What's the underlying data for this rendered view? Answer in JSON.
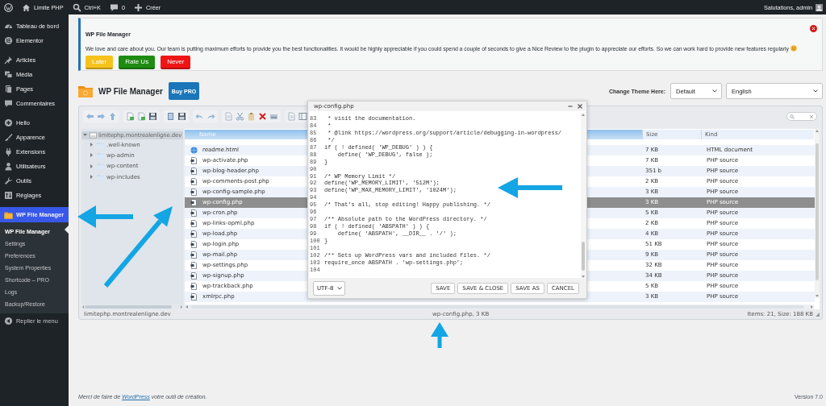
{
  "admin_bar": {
    "items": [
      {
        "kind": "logo"
      },
      {
        "kind": "home",
        "label": "Limite PHP"
      },
      {
        "kind": "search",
        "label": "Ctrl+K"
      },
      {
        "kind": "comments",
        "label": "0"
      },
      {
        "kind": "new",
        "label": "Créer"
      }
    ],
    "greeting": "Salutations, admin"
  },
  "sidebar": {
    "groups": [
      {
        "items": [
          {
            "label": "Tableau de bord",
            "kind": "gauge",
            "selected": false
          },
          {
            "label": "Elementor",
            "kind": "elementor",
            "selected": false
          }
        ]
      },
      {
        "items": [
          {
            "label": "Articles",
            "kind": "pin",
            "selected": false
          },
          {
            "label": "Média",
            "kind": "media",
            "selected": false
          },
          {
            "label": "Pages",
            "kind": "pages",
            "selected": false
          },
          {
            "label": "Commentaires",
            "kind": "comment",
            "selected": false
          }
        ]
      },
      {
        "items": [
          {
            "label": "Hello",
            "kind": "hello",
            "selected": false
          },
          {
            "label": "Apparence",
            "kind": "brush",
            "selected": false
          },
          {
            "label": "Extensions",
            "kind": "plug",
            "selected": false
          },
          {
            "label": "Utilisateurs",
            "kind": "user",
            "selected": false
          },
          {
            "label": "Outils",
            "kind": "wrench",
            "selected": false
          },
          {
            "label": "Réglages",
            "kind": "sliders",
            "selected": false
          }
        ]
      },
      {
        "items": [
          {
            "label": "WP File Manager",
            "kind": "folder",
            "selected": true,
            "submenu": [
              {
                "label": "WP File Manager",
                "selected": true
              },
              {
                "label": "Settings",
                "selected": false
              },
              {
                "label": "Preferences",
                "selected": false
              },
              {
                "label": "System Properties",
                "selected": false
              },
              {
                "label": "Shortcode – PRO",
                "selected": false
              },
              {
                "label": "Logs",
                "selected": false
              },
              {
                "label": "Backup/Restore",
                "selected": false
              }
            ]
          }
        ]
      }
    ],
    "collapse": "Replier le menu"
  },
  "notice": {
    "title": "WP File Manager",
    "message": "We love and care about you. Our team is putting maximum efforts to provide you the best functionalities. It would be highly appreciable if you could spend a couple of seconds to give a Nice Review to the plugin to appreciate our efforts. So we can work hard to provide new features regularly",
    "buttons": [
      {
        "label": "Later",
        "color": "#f6c21c"
      },
      {
        "label": "Rate Us",
        "color": "#1e8c12"
      },
      {
        "label": "Never",
        "color": "#f01414"
      }
    ]
  },
  "header": {
    "title": "WP File Manager",
    "buy_button": "Buy PRO",
    "theme_label": "Change Theme Here:",
    "theme_select": "Default",
    "language_select": "English"
  },
  "file_manager": {
    "tree": {
      "label": "limitephp.montrealenligne.dev",
      "expanded": true,
      "selected": true,
      "children": [
        {
          "label": ".well-known",
          "expanded": false
        },
        {
          "label": "wp-admin",
          "expanded": false
        },
        {
          "label": "wp-content",
          "expanded": false
        },
        {
          "label": "wp-includes",
          "expanded": false
        }
      ]
    },
    "columns": [
      "Name",
      "Size",
      "Kind"
    ],
    "rows": [
      {
        "name": "readme.html",
        "size": "7 KB",
        "type": "HTML document",
        "kind": "html",
        "selected": false
      },
      {
        "name": "wp-activate.php",
        "size": "7 KB",
        "type": "PHP source",
        "kind": "php",
        "selected": false
      },
      {
        "name": "wp-blog-header.php",
        "size": "351 b",
        "type": "PHP source",
        "kind": "php",
        "selected": false
      },
      {
        "name": "wp-comments-post.php",
        "size": "2 KB",
        "type": "PHP source",
        "kind": "php",
        "selected": false
      },
      {
        "name": "wp-config-sample.php",
        "size": "3 KB",
        "type": "PHP source",
        "kind": "php",
        "selected": false
      },
      {
        "name": "wp-config.php",
        "size": "3 KB",
        "type": "PHP source",
        "kind": "php",
        "selected": true
      },
      {
        "name": "wp-cron.php",
        "size": "5 KB",
        "type": "PHP source",
        "kind": "php",
        "selected": false
      },
      {
        "name": "wp-links-opml.php",
        "size": "2 KB",
        "type": "PHP source",
        "kind": "php",
        "selected": false
      },
      {
        "name": "wp-load.php",
        "size": "4 KB",
        "type": "PHP source",
        "kind": "php",
        "selected": false
      },
      {
        "name": "wp-login.php",
        "size": "51 KB",
        "type": "PHP source",
        "kind": "php",
        "selected": false
      },
      {
        "name": "wp-mail.php",
        "size": "9 KB",
        "type": "PHP source",
        "kind": "php",
        "selected": false
      },
      {
        "name": "wp-settings.php",
        "size": "32 KB",
        "type": "PHP source",
        "kind": "php",
        "selected": false
      },
      {
        "name": "wp-signup.php",
        "size": "34 KB",
        "type": "PHP source",
        "kind": "php",
        "selected": false
      },
      {
        "name": "wp-trackback.php",
        "size": "5 KB",
        "type": "PHP source",
        "kind": "php",
        "selected": false
      },
      {
        "name": "xmlrpc.php",
        "size": "3 KB",
        "type": "PHP source",
        "kind": "php",
        "selected": false
      }
    ],
    "status": {
      "path": "limitephp.montrealenligne.dev",
      "selection": "wp-config.php, 3 KB",
      "summary": "Items: 21, Size: 188 KB"
    }
  },
  "editor": {
    "title": "wp-config.php",
    "lines": [
      {
        "number": "83",
        "code": " * visit the documentation."
      },
      {
        "number": "84",
        "code": " *"
      },
      {
        "number": "85",
        "code": " * @link https://wordpress.org/support/article/debugging-in-wordpress/"
      },
      {
        "number": "86",
        "code": " */"
      },
      {
        "number": "87",
        "code": "if ( ! defined( 'WP_DEBUG' ) ) {"
      },
      {
        "number": "88",
        "code": "    define( 'WP_DEBUG', false );"
      },
      {
        "number": "89",
        "code": "}"
      },
      {
        "number": "90"
      },
      {
        "number": "91",
        "code": "/* WP Memory Limit */"
      },
      {
        "number": "92",
        "code": "define('WP_MEMORY_LIMIT', '512M');"
      },
      {
        "number": "93",
        "code": "define('WP_MAX_MEMORY_LIMIT', '1024M');"
      },
      {
        "number": "94"
      },
      {
        "number": "95",
        "code": "/* That's all, stop editing! Happy publishing. */"
      },
      {
        "number": "96"
      },
      {
        "number": "97",
        "code": "/** Absolute path to the WordPress directory. */"
      },
      {
        "number": "98",
        "code": "if ( ! defined( 'ABSPATH' ) ) {"
      },
      {
        "number": "99",
        "code": "    define( 'ABSPATH', __DIR__ . '/' );"
      },
      {
        "number": "100",
        "code": "}"
      },
      {
        "number": "101"
      },
      {
        "number": "102",
        "code": "/** Sets up WordPress vars and included files. */"
      },
      {
        "number": "103",
        "code": "require_once ABSPATH . 'wp-settings.php';"
      },
      {
        "number": "104"
      }
    ],
    "encoding": "UTF-8",
    "buttons": [
      "SAVE",
      "SAVE & CLOSE",
      "SAVE AS",
      "CANCEL"
    ]
  },
  "annotations": [
    {
      "kind": "arrow"
    },
    {
      "kind": "arrow"
    },
    {
      "kind": "arrow"
    },
    {
      "kind": "arrow"
    }
  ],
  "footer": {
    "before": "Merci de faire de",
    "link": "WordPress",
    "after": "votre outil de création.",
    "version": "Version 7.0"
  }
}
